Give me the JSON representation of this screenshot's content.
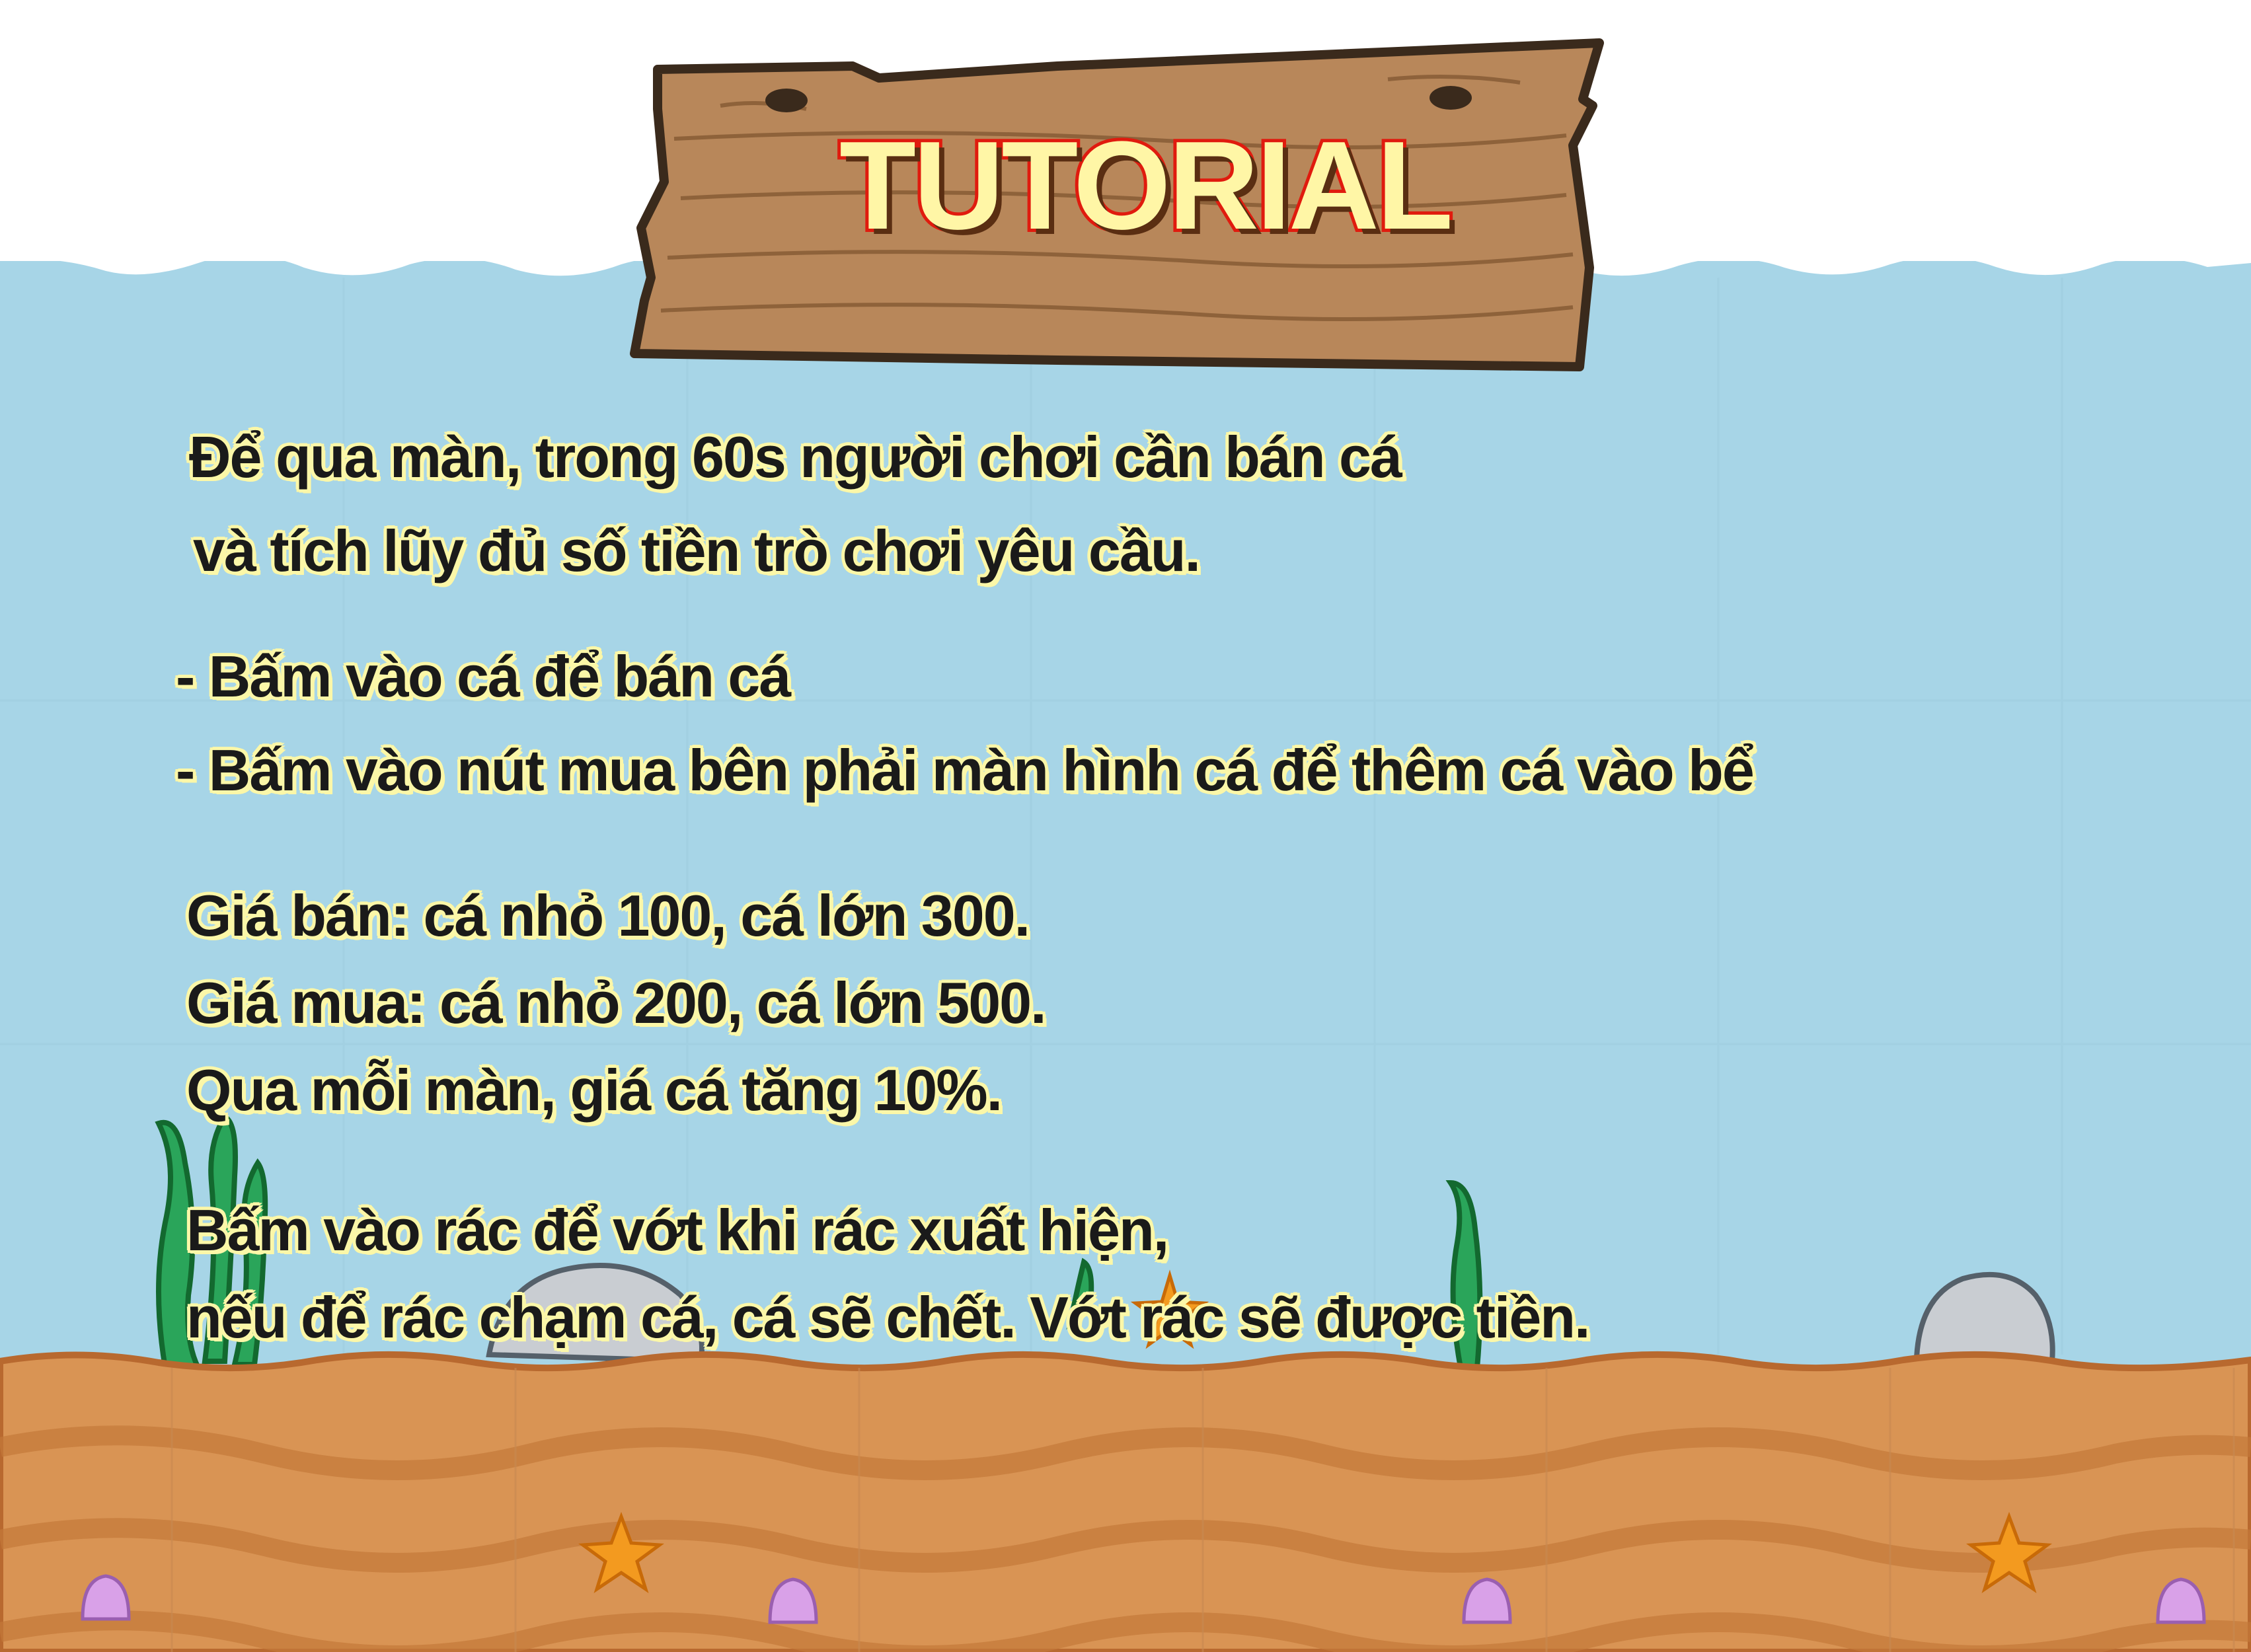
{
  "title": "TUTORIAL",
  "intro": [
    "Để qua màn, trong 60s người chơi cần bán cá",
    "và tích lũy đủ số tiền trò chơi yêu cầu."
  ],
  "instructions": [
    "- Bấm vào cá để bán cá",
    "- Bấm vào nút mua bên phải màn hình cá để thêm cá vào bể"
  ],
  "prices": [
    "Giá bán: cá nhỏ 100, cá lớn 300.",
    "Giá mua: cá nhỏ 200, cá lớn 500.",
    "Qua mỗi màn, giá cá tăng 10%."
  ],
  "trash": [
    "Bấm vào rác để vớt khi rác xuất hiện,",
    "nếu để rác chạm cá, cá sẽ chết. Vớt rác sẽ được tiền."
  ],
  "colors": {
    "sky": "#ffffff",
    "water": "#a7d5e7",
    "water_wave": "#c9e5ef",
    "sand": "#d99454",
    "sand_dark": "#c47a3a",
    "sand_edge": "#b8692f",
    "wood": "#b8875a",
    "wood_outline": "#3a2a1c",
    "title_fill": "#fff6a6",
    "title_stroke": "#e01b0e",
    "text": "#1a1a1a",
    "text_outline": "#fbf7a8"
  },
  "icons": [
    "wooden-sign-icon",
    "seaweed-icon",
    "rock-icon",
    "starfish-icon",
    "seashell-icon"
  ]
}
